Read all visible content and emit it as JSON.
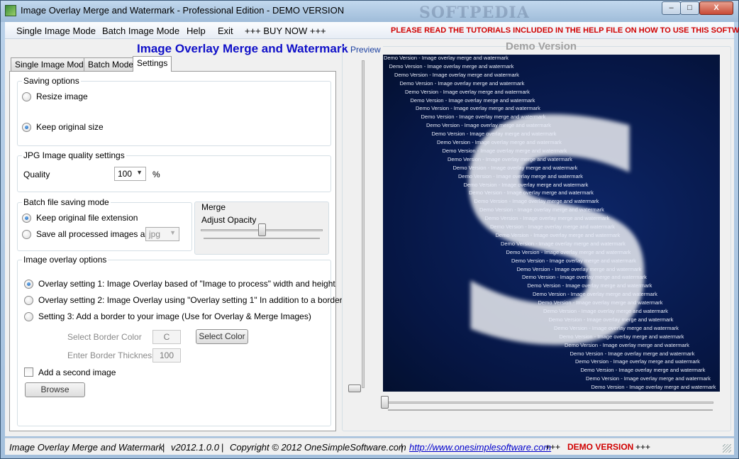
{
  "window": {
    "title": "Image Overlay Merge and Watermark - Professional Edition - DEMO VERSION",
    "background_watermark": "SOFTPEDIA",
    "buttons": {
      "minimize": "–",
      "maximize": "□",
      "close": "X"
    }
  },
  "menu": {
    "items": [
      "Single Image Mode",
      "Batch Image Mode",
      "Help",
      "Exit",
      "+++ BUY NOW +++"
    ],
    "warning": "PLEASE READ THE TUTORIALS INCLUDED IN THE HELP FILE ON HOW TO USE THIS SOFTWARE"
  },
  "app_heading": "Image Overlay Merge and Watermark",
  "tabs": [
    {
      "label": "Single Image Mode",
      "active": false
    },
    {
      "label": "Batch Mode",
      "active": false
    },
    {
      "label": "Settings",
      "active": true
    }
  ],
  "saving_options": {
    "title": "Saving options",
    "options": [
      {
        "label": "Resize image",
        "checked": false
      },
      {
        "label": "Keep original size",
        "checked": true
      }
    ]
  },
  "jpg_quality": {
    "title": "JPG Image quality settings",
    "label": "Quality",
    "value": "100",
    "unit": "%"
  },
  "batch_saving": {
    "title": "Batch file saving mode",
    "options": [
      {
        "label": "Keep original file extension",
        "checked": true
      },
      {
        "label": "Save all processed images as",
        "checked": false
      }
    ],
    "format_value": "jpg"
  },
  "merge": {
    "title": "Merge",
    "opacity_label": "Adjust Opacity",
    "opacity_level": 0.5
  },
  "overlay_options": {
    "title": "Image overlay options",
    "options": [
      {
        "label": "Overlay setting 1: Image Overlay based of \"Image to process\" width and height",
        "checked": true
      },
      {
        "label": "Overlay setting 2: Image Overlay using \"Overlay setting 1\" In addition to a border",
        "checked": false
      },
      {
        "label": "Setting 3: Add a border to your image (Use for Overlay & Merge Images)",
        "checked": false
      }
    ],
    "border_color_label": "Select Border Color",
    "border_color_value": "C",
    "select_color_button": "Select Color",
    "border_thickness_label": "Enter Border Thickness",
    "border_thickness_value": "100",
    "second_image_label": "Add a second image",
    "browse_button": "Browse"
  },
  "preview": {
    "label": "Preview",
    "demo_heading": "Demo Version",
    "watermark_line": "Demo Version - Image overlay merge and watermark",
    "big_glyph": "S"
  },
  "status": {
    "app_name": "Image Overlay Merge and Watermark",
    "version": "v2012.1.0.0",
    "copyright": "Copyright © 2012 OneSimpleSoftware.com",
    "link": "http://www.onesimplesoftware.com",
    "plus_left": "+++",
    "demo": "DEMO VERSION",
    "plus_right": "+++",
    "separator": "|"
  }
}
